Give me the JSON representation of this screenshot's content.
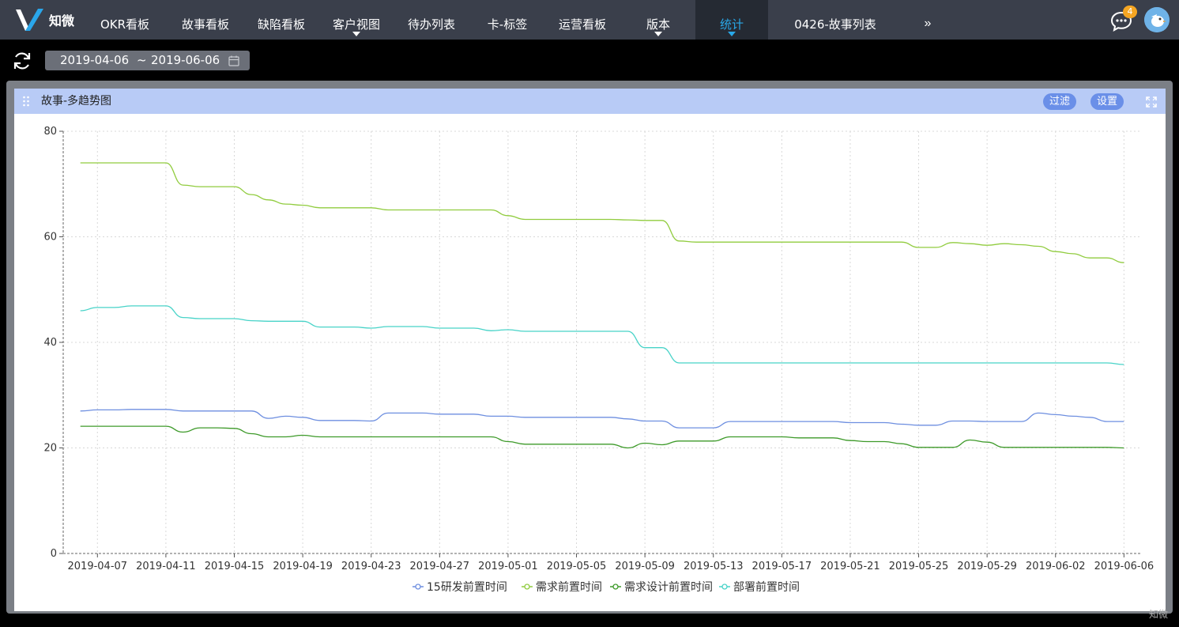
{
  "app": {
    "logo_text": "知微",
    "notification_count": "4",
    "watermark": "知微"
  },
  "nav": {
    "items": [
      {
        "label": "OKR看板",
        "caret": false,
        "active": false
      },
      {
        "label": "故事看板",
        "caret": false,
        "active": false
      },
      {
        "label": "缺陷看板",
        "caret": false,
        "active": false
      },
      {
        "label": "客户视图",
        "caret": true,
        "active": false
      },
      {
        "label": "待办列表",
        "caret": false,
        "active": false
      },
      {
        "label": "卡-标签",
        "caret": false,
        "active": false
      },
      {
        "label": "运营看板",
        "caret": false,
        "active": false
      },
      {
        "label": "版本",
        "caret": true,
        "active": false
      },
      {
        "label": "统计",
        "caret": true,
        "active": true
      },
      {
        "label": "0426-故事列表",
        "caret": false,
        "active": false
      }
    ],
    "more": "»"
  },
  "toolbar": {
    "date_start": "2019-04-06",
    "date_sep": "~",
    "date_end": "2019-06-06"
  },
  "panel": {
    "title": "故事-多趋势图",
    "filter_label": "过滤",
    "settings_label": "设置"
  },
  "colors": {
    "nav_bg": "#3a3f4b",
    "nav_active_bg": "#252a33",
    "nav_active_text": "#29a8e8",
    "panel_header_bg": "#b8cbf6",
    "header_button_bg": "#6a8fe8"
  },
  "chart_data": {
    "type": "line",
    "grid": true,
    "legend_placement": "bottom-center",
    "ylim": [
      0,
      80
    ],
    "yticks": [
      0,
      20,
      40,
      60,
      80
    ],
    "xlim": [
      "2019-04-05",
      "2019-06-07"
    ],
    "xticks": [
      "2019-04-07",
      "2019-04-11",
      "2019-04-15",
      "2019-04-19",
      "2019-04-23",
      "2019-04-27",
      "2019-05-01",
      "2019-05-05",
      "2019-05-09",
      "2019-05-13",
      "2019-05-17",
      "2019-05-21",
      "2019-05-25",
      "2019-05-29",
      "2019-06-02",
      "2019-06-06"
    ],
    "series": [
      {
        "name": "15研发前置时间",
        "color": "#6e8fe0",
        "points": [
          [
            "2019-04-06",
            27.0
          ],
          [
            "2019-04-07",
            27.2
          ],
          [
            "2019-04-08",
            27.2
          ],
          [
            "2019-04-09",
            27.3
          ],
          [
            "2019-04-10",
            27.3
          ],
          [
            "2019-04-11",
            27.3
          ],
          [
            "2019-04-12",
            27.0
          ],
          [
            "2019-04-13",
            27.0
          ],
          [
            "2019-04-14",
            27.0
          ],
          [
            "2019-04-15",
            27.0
          ],
          [
            "2019-04-16",
            27.0
          ],
          [
            "2019-04-17",
            25.6
          ],
          [
            "2019-04-18",
            26.0
          ],
          [
            "2019-04-19",
            25.8
          ],
          [
            "2019-04-20",
            25.2
          ],
          [
            "2019-04-21",
            25.2
          ],
          [
            "2019-04-22",
            25.2
          ],
          [
            "2019-04-23",
            25.1
          ],
          [
            "2019-04-24",
            26.6
          ],
          [
            "2019-04-25",
            26.6
          ],
          [
            "2019-04-26",
            26.6
          ],
          [
            "2019-04-27",
            26.4
          ],
          [
            "2019-04-28",
            26.4
          ],
          [
            "2019-04-29",
            26.4
          ],
          [
            "2019-04-30",
            26.0
          ],
          [
            "2019-05-01",
            26.0
          ],
          [
            "2019-05-02",
            25.8
          ],
          [
            "2019-05-03",
            25.8
          ],
          [
            "2019-05-04",
            25.8
          ],
          [
            "2019-05-05",
            25.8
          ],
          [
            "2019-05-06",
            25.8
          ],
          [
            "2019-05-07",
            25.8
          ],
          [
            "2019-05-08",
            25.5
          ],
          [
            "2019-05-09",
            25.1
          ],
          [
            "2019-05-10",
            25.1
          ],
          [
            "2019-05-11",
            23.8
          ],
          [
            "2019-05-12",
            23.8
          ],
          [
            "2019-05-13",
            23.8
          ],
          [
            "2019-05-14",
            25.0
          ],
          [
            "2019-05-15",
            25.0
          ],
          [
            "2019-05-16",
            25.0
          ],
          [
            "2019-05-17",
            25.0
          ],
          [
            "2019-05-18",
            25.0
          ],
          [
            "2019-05-19",
            25.0
          ],
          [
            "2019-05-20",
            25.0
          ],
          [
            "2019-05-21",
            24.8
          ],
          [
            "2019-05-22",
            24.8
          ],
          [
            "2019-05-23",
            24.8
          ],
          [
            "2019-05-24",
            24.5
          ],
          [
            "2019-05-25",
            24.3
          ],
          [
            "2019-05-26",
            24.3
          ],
          [
            "2019-05-27",
            25.1
          ],
          [
            "2019-05-28",
            25.1
          ],
          [
            "2019-05-29",
            25.0
          ],
          [
            "2019-05-30",
            25.0
          ],
          [
            "2019-05-31",
            25.0
          ],
          [
            "2019-06-01",
            26.6
          ],
          [
            "2019-06-02",
            26.3
          ],
          [
            "2019-06-03",
            26.0
          ],
          [
            "2019-06-04",
            25.8
          ],
          [
            "2019-06-05",
            25.0
          ],
          [
            "2019-06-06",
            25.0
          ]
        ]
      },
      {
        "name": "需求前置时间",
        "color": "#91cc3f",
        "points": [
          [
            "2019-04-06",
            74.0
          ],
          [
            "2019-04-07",
            74.0
          ],
          [
            "2019-04-08",
            74.0
          ],
          [
            "2019-04-09",
            74.0
          ],
          [
            "2019-04-10",
            74.0
          ],
          [
            "2019-04-11",
            74.0
          ],
          [
            "2019-04-12",
            69.8
          ],
          [
            "2019-04-13",
            69.5
          ],
          [
            "2019-04-14",
            69.5
          ],
          [
            "2019-04-15",
            69.5
          ],
          [
            "2019-04-16",
            68.0
          ],
          [
            "2019-04-17",
            67.0
          ],
          [
            "2019-04-18",
            66.2
          ],
          [
            "2019-04-19",
            66.0
          ],
          [
            "2019-04-20",
            65.5
          ],
          [
            "2019-04-21",
            65.5
          ],
          [
            "2019-04-22",
            65.5
          ],
          [
            "2019-04-23",
            65.5
          ],
          [
            "2019-04-24",
            65.1
          ],
          [
            "2019-04-25",
            65.1
          ],
          [
            "2019-04-26",
            65.1
          ],
          [
            "2019-04-27",
            65.1
          ],
          [
            "2019-04-28",
            65.1
          ],
          [
            "2019-04-29",
            65.1
          ],
          [
            "2019-04-30",
            65.1
          ],
          [
            "2019-05-01",
            64.0
          ],
          [
            "2019-05-02",
            63.3
          ],
          [
            "2019-05-03",
            63.3
          ],
          [
            "2019-05-04",
            63.3
          ],
          [
            "2019-05-05",
            63.3
          ],
          [
            "2019-05-06",
            63.3
          ],
          [
            "2019-05-07",
            63.3
          ],
          [
            "2019-05-08",
            63.2
          ],
          [
            "2019-05-09",
            63.1
          ],
          [
            "2019-05-10",
            63.1
          ],
          [
            "2019-05-11",
            59.2
          ],
          [
            "2019-05-12",
            59.0
          ],
          [
            "2019-05-13",
            59.0
          ],
          [
            "2019-05-14",
            59.0
          ],
          [
            "2019-05-15",
            59.0
          ],
          [
            "2019-05-16",
            59.0
          ],
          [
            "2019-05-17",
            59.0
          ],
          [
            "2019-05-18",
            59.0
          ],
          [
            "2019-05-19",
            59.0
          ],
          [
            "2019-05-20",
            59.0
          ],
          [
            "2019-05-21",
            59.0
          ],
          [
            "2019-05-22",
            59.0
          ],
          [
            "2019-05-23",
            59.0
          ],
          [
            "2019-05-24",
            59.0
          ],
          [
            "2019-05-25",
            58.0
          ],
          [
            "2019-05-26",
            58.0
          ],
          [
            "2019-05-27",
            58.9
          ],
          [
            "2019-05-28",
            58.7
          ],
          [
            "2019-05-29",
            58.4
          ],
          [
            "2019-05-30",
            58.7
          ],
          [
            "2019-05-31",
            58.5
          ],
          [
            "2019-06-01",
            58.2
          ],
          [
            "2019-06-02",
            57.2
          ],
          [
            "2019-06-03",
            56.8
          ],
          [
            "2019-06-04",
            56.0
          ],
          [
            "2019-06-05",
            56.0
          ],
          [
            "2019-06-06",
            55.1
          ]
        ]
      },
      {
        "name": "需求设计前置时间",
        "color": "#3e9a2a",
        "points": [
          [
            "2019-04-06",
            24.1
          ],
          [
            "2019-04-07",
            24.1
          ],
          [
            "2019-04-08",
            24.1
          ],
          [
            "2019-04-09",
            24.1
          ],
          [
            "2019-04-10",
            24.1
          ],
          [
            "2019-04-11",
            24.1
          ],
          [
            "2019-04-12",
            23.0
          ],
          [
            "2019-04-13",
            23.8
          ],
          [
            "2019-04-14",
            23.8
          ],
          [
            "2019-04-15",
            23.7
          ],
          [
            "2019-04-16",
            22.7
          ],
          [
            "2019-04-17",
            22.1
          ],
          [
            "2019-04-18",
            22.1
          ],
          [
            "2019-04-19",
            22.4
          ],
          [
            "2019-04-20",
            22.1
          ],
          [
            "2019-04-21",
            22.1
          ],
          [
            "2019-04-22",
            22.1
          ],
          [
            "2019-04-23",
            22.1
          ],
          [
            "2019-04-24",
            22.1
          ],
          [
            "2019-04-25",
            22.1
          ],
          [
            "2019-04-26",
            22.1
          ],
          [
            "2019-04-27",
            22.1
          ],
          [
            "2019-04-28",
            22.1
          ],
          [
            "2019-04-29",
            22.1
          ],
          [
            "2019-04-30",
            22.1
          ],
          [
            "2019-05-01",
            21.2
          ],
          [
            "2019-05-02",
            20.7
          ],
          [
            "2019-05-03",
            20.7
          ],
          [
            "2019-05-04",
            20.7
          ],
          [
            "2019-05-05",
            20.7
          ],
          [
            "2019-05-06",
            20.7
          ],
          [
            "2019-05-07",
            20.7
          ],
          [
            "2019-05-08",
            20.0
          ],
          [
            "2019-05-09",
            20.9
          ],
          [
            "2019-05-10",
            20.6
          ],
          [
            "2019-05-11",
            21.3
          ],
          [
            "2019-05-12",
            21.3
          ],
          [
            "2019-05-13",
            21.3
          ],
          [
            "2019-05-14",
            22.1
          ],
          [
            "2019-05-15",
            22.1
          ],
          [
            "2019-05-16",
            22.1
          ],
          [
            "2019-05-17",
            22.1
          ],
          [
            "2019-05-18",
            21.9
          ],
          [
            "2019-05-19",
            21.9
          ],
          [
            "2019-05-20",
            21.9
          ],
          [
            "2019-05-21",
            21.4
          ],
          [
            "2019-05-22",
            21.2
          ],
          [
            "2019-05-23",
            21.2
          ],
          [
            "2019-05-24",
            20.8
          ],
          [
            "2019-05-25",
            20.1
          ],
          [
            "2019-05-26",
            20.1
          ],
          [
            "2019-05-27",
            20.1
          ],
          [
            "2019-05-28",
            21.5
          ],
          [
            "2019-05-29",
            21.1
          ],
          [
            "2019-05-30",
            20.1
          ],
          [
            "2019-05-31",
            20.1
          ],
          [
            "2019-06-01",
            20.1
          ],
          [
            "2019-06-02",
            20.1
          ],
          [
            "2019-06-03",
            20.1
          ],
          [
            "2019-06-04",
            20.1
          ],
          [
            "2019-06-05",
            20.1
          ],
          [
            "2019-06-06",
            20.0
          ]
        ]
      },
      {
        "name": "部署前置时间",
        "color": "#48d3c8",
        "points": [
          [
            "2019-04-06",
            46.0
          ],
          [
            "2019-04-07",
            46.6
          ],
          [
            "2019-04-08",
            46.6
          ],
          [
            "2019-04-09",
            46.9
          ],
          [
            "2019-04-10",
            46.9
          ],
          [
            "2019-04-11",
            46.9
          ],
          [
            "2019-04-12",
            44.7
          ],
          [
            "2019-04-13",
            44.5
          ],
          [
            "2019-04-14",
            44.5
          ],
          [
            "2019-04-15",
            44.5
          ],
          [
            "2019-04-16",
            44.1
          ],
          [
            "2019-04-17",
            44.0
          ],
          [
            "2019-04-18",
            44.0
          ],
          [
            "2019-04-19",
            44.0
          ],
          [
            "2019-04-20",
            42.9
          ],
          [
            "2019-04-21",
            42.9
          ],
          [
            "2019-04-22",
            42.9
          ],
          [
            "2019-04-23",
            42.7
          ],
          [
            "2019-04-24",
            43.0
          ],
          [
            "2019-04-25",
            43.0
          ],
          [
            "2019-04-26",
            43.0
          ],
          [
            "2019-04-27",
            42.7
          ],
          [
            "2019-04-28",
            42.7
          ],
          [
            "2019-04-29",
            42.7
          ],
          [
            "2019-04-30",
            42.2
          ],
          [
            "2019-05-01",
            42.4
          ],
          [
            "2019-05-02",
            42.1
          ],
          [
            "2019-05-03",
            42.1
          ],
          [
            "2019-05-04",
            42.1
          ],
          [
            "2019-05-05",
            42.1
          ],
          [
            "2019-05-06",
            42.1
          ],
          [
            "2019-05-07",
            42.1
          ],
          [
            "2019-05-08",
            42.1
          ],
          [
            "2019-05-09",
            39.0
          ],
          [
            "2019-05-10",
            39.0
          ],
          [
            "2019-05-11",
            36.1
          ],
          [
            "2019-05-12",
            36.1
          ],
          [
            "2019-05-13",
            36.1
          ],
          [
            "2019-05-14",
            36.1
          ],
          [
            "2019-05-15",
            36.1
          ],
          [
            "2019-05-16",
            36.1
          ],
          [
            "2019-05-17",
            36.1
          ],
          [
            "2019-05-18",
            36.1
          ],
          [
            "2019-05-19",
            36.1
          ],
          [
            "2019-05-20",
            36.1
          ],
          [
            "2019-05-21",
            36.1
          ],
          [
            "2019-05-22",
            36.1
          ],
          [
            "2019-05-23",
            36.1
          ],
          [
            "2019-05-24",
            36.1
          ],
          [
            "2019-05-25",
            36.1
          ],
          [
            "2019-05-26",
            36.1
          ],
          [
            "2019-05-27",
            36.1
          ],
          [
            "2019-05-28",
            36.1
          ],
          [
            "2019-05-29",
            36.1
          ],
          [
            "2019-05-30",
            36.1
          ],
          [
            "2019-05-31",
            36.1
          ],
          [
            "2019-06-01",
            36.1
          ],
          [
            "2019-06-02",
            36.1
          ],
          [
            "2019-06-03",
            36.1
          ],
          [
            "2019-06-04",
            36.1
          ],
          [
            "2019-06-05",
            36.1
          ],
          [
            "2019-06-06",
            35.8
          ]
        ]
      }
    ]
  }
}
